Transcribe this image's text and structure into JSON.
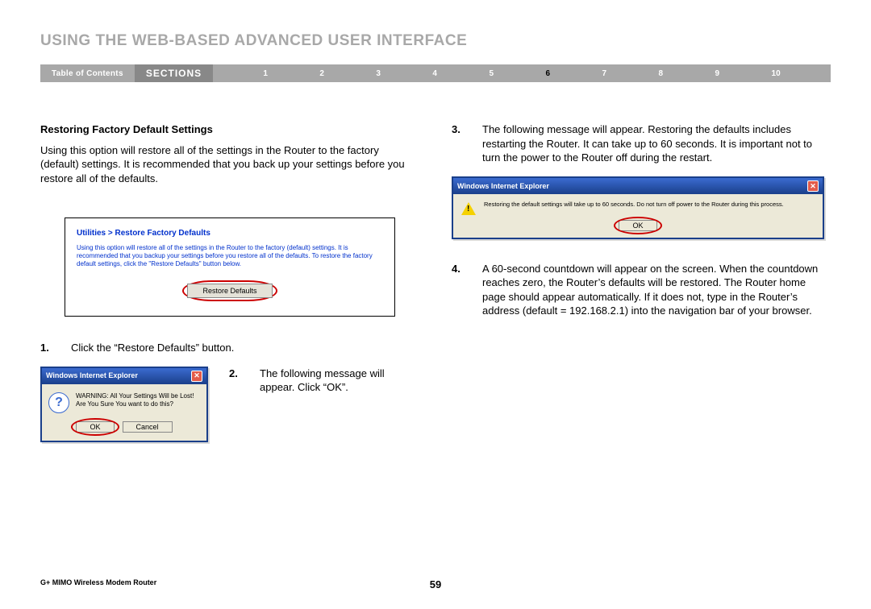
{
  "page_title": "USING THE WEB-BASED ADVANCED USER INTERFACE",
  "nav": {
    "toc": "Table of Contents",
    "sections_label": "SECTIONS",
    "items": [
      "1",
      "2",
      "3",
      "4",
      "5",
      "6",
      "7",
      "8",
      "9",
      "10"
    ],
    "active_index": 5
  },
  "left": {
    "subheading": "Restoring Factory Default Settings",
    "intro": "Using this option will restore all of the settings in the Router to the factory (default) settings. It is recommended that you back up your settings before you restore all of the defaults.",
    "util_box": {
      "title": "Utilities > Restore Factory Defaults",
      "text": "Using this option will restore all of the settings in the Router to the factory (default) settings. It is recommended that you backup your settings before you restore all of the defaults. To restore the factory default settings, click the \"Restore Defaults\" button below.",
      "button": "Restore Defaults"
    },
    "step1_num": "1.",
    "step1_text": "Click the “Restore Defaults” button.",
    "step2_num": "2.",
    "step2_text": "The following message will appear. Click “OK”.",
    "dialog1": {
      "title": "Windows Internet Explorer",
      "msg": "WARNING: All Your Settings Will be Lost! Are You Sure You want to do this?",
      "ok": "OK",
      "cancel": "Cancel"
    }
  },
  "right": {
    "step3_num": "3.",
    "step3_text": "The following message will appear. Restoring the defaults includes restarting the Router. It can take up to 60 seconds. It is important not to turn the power to the Router off during the restart.",
    "dialog2": {
      "title": "Windows Internet Explorer",
      "msg": "Restoring the default settings will take up to 60 seconds. Do not turn off power to the Router during this process.",
      "ok": "OK"
    },
    "step4_num": "4.",
    "step4_text": "A 60-second countdown will appear on the screen. When the countdown reaches zero, the Router’s defaults will be restored. The Router home page should appear automatically. If it does not, type in the Router’s address (default = 192.168.2.1) into the navigation bar of your browser."
  },
  "footer": {
    "product": "G+ MIMO Wireless Modem Router",
    "page_num": "59"
  }
}
